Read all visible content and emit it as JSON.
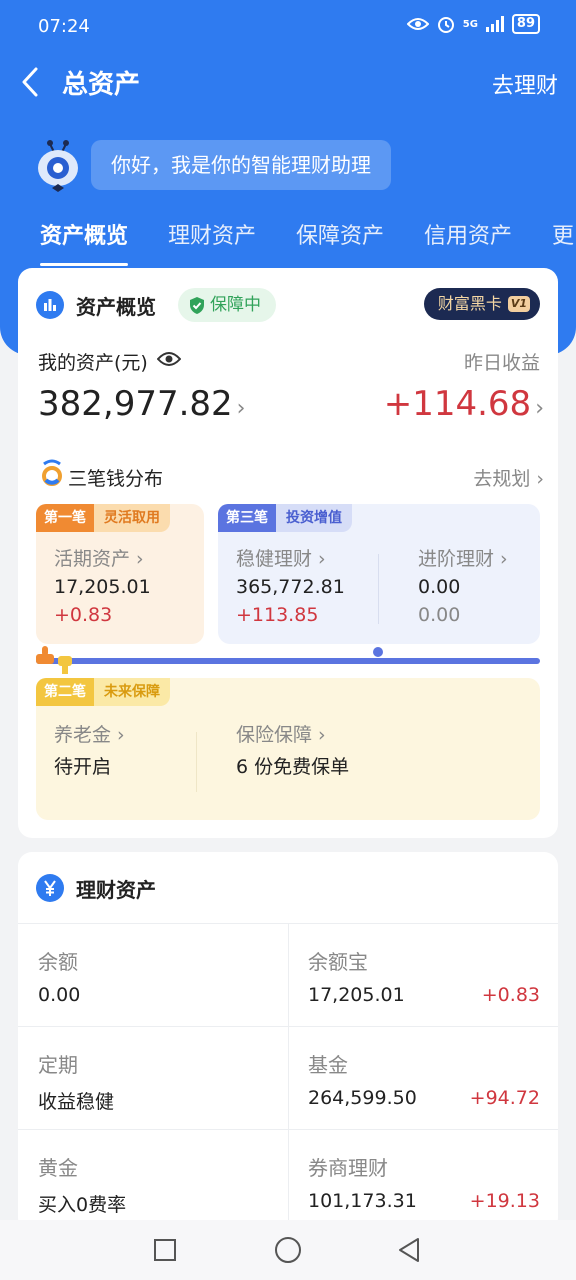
{
  "status_bar": {
    "time": "07:24",
    "network": "5G",
    "battery": "89"
  },
  "nav": {
    "title": "总资产",
    "right_action": "去理财"
  },
  "assistant": {
    "greeting": "你好，我是你的智能理财助理"
  },
  "tabs": [
    "资产概览",
    "理财资产",
    "保障资产",
    "信用资产",
    "更"
  ],
  "overview": {
    "title": "资产概览",
    "protection_badge": "保障中",
    "black_card": "财富黑卡",
    "black_card_level": "V1",
    "my_assets_label": "我的资产(元)",
    "my_assets_value": "382,977.82",
    "yesterday_label": "昨日收益",
    "yesterday_value": "+114.68",
    "three_money_title": "三笔钱分布",
    "plan_link": "去规划",
    "first": {
      "tag_no": "第一笔",
      "tag_name": "灵活取用",
      "label": "活期资产",
      "value": "17,205.01",
      "change": "+0.83"
    },
    "third": {
      "tag_no": "第三笔",
      "tag_name": "投资增值",
      "items": [
        {
          "label": "稳健理财",
          "value": "365,772.81",
          "change": "+113.85"
        },
        {
          "label": "进阶理财",
          "value": "0.00",
          "change": "0.00"
        }
      ]
    },
    "second": {
      "tag_no": "第二笔",
      "tag_name": "未来保障",
      "items": [
        {
          "label": "养老金",
          "value": "待开启"
        },
        {
          "label": "保险保障",
          "value": "6 份免费保单"
        }
      ]
    }
  },
  "wealth": {
    "title": "理财资产",
    "rows": [
      {
        "left": {
          "label": "余额",
          "value": "0.00"
        },
        "right": {
          "label": "余额宝",
          "value": "17,205.01",
          "change": "+0.83"
        }
      },
      {
        "left": {
          "label": "定期",
          "value": "收益稳健"
        },
        "right": {
          "label": "基金",
          "value": "264,599.50",
          "change": "+94.72"
        }
      },
      {
        "left": {
          "label": "黄金",
          "value": "买入0费率"
        },
        "right": {
          "label": "券商理财",
          "value": "101,173.31",
          "change": "+19.13"
        }
      }
    ]
  },
  "colors": {
    "brand_blue": "#2f7bf0",
    "gain_red": "#d0373f",
    "protect_green": "#31a35a"
  }
}
